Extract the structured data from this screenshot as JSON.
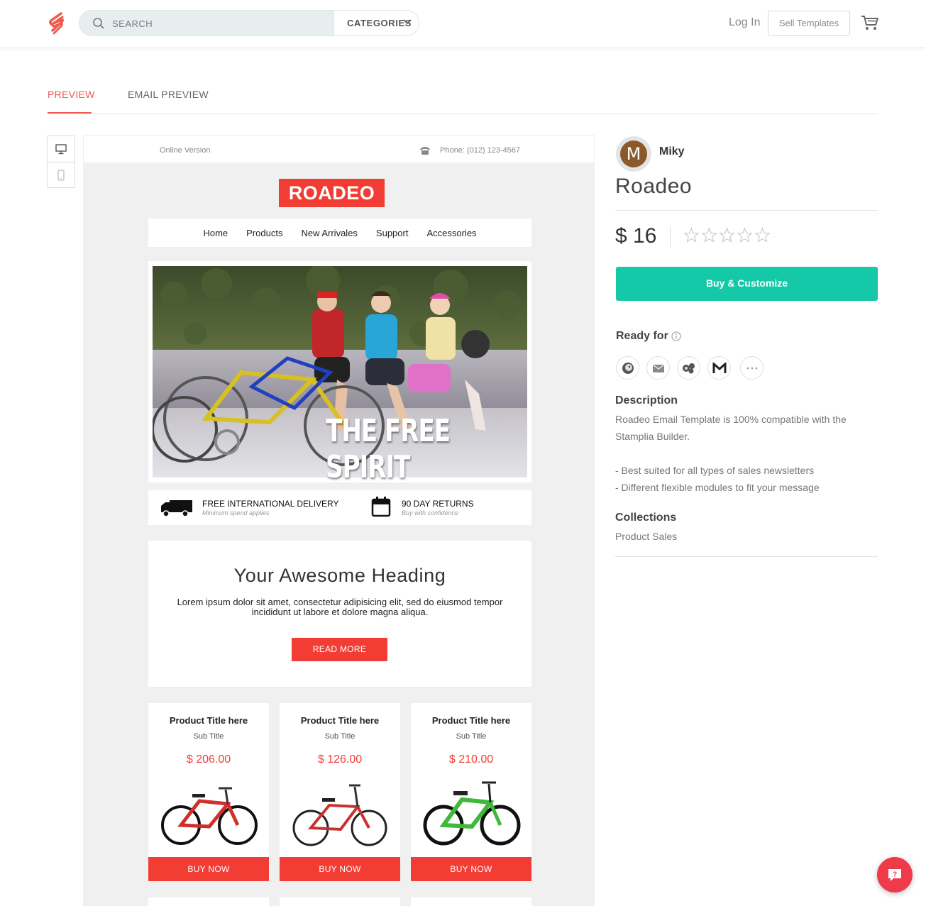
{
  "header": {
    "search_placeholder": "SEARCH",
    "categories_label": "CATEGORIES",
    "login_label": "Log In",
    "sell_label": "Sell Templates"
  },
  "tabs": {
    "preview": "PREVIEW",
    "email_preview": "EMAIL PREVIEW"
  },
  "email": {
    "online_version": "Online Version",
    "phone": "Phone: (012) 123-4567",
    "brand": "ROADEO",
    "nav": [
      "Home",
      "Products",
      "New Arrivales",
      "Support",
      "Accessories"
    ],
    "hero_text": "THE FREE SPIRIT",
    "features": [
      {
        "title": "FREE INTERNATIONAL DELIVERY",
        "subtitle": "Minimum spend applies"
      },
      {
        "title": "90 DAY RETURNS",
        "subtitle": "Buy with confidence"
      }
    ],
    "heading": "Your Awesome Heading",
    "body": "Lorem ipsum dolor sit amet, consectetur adipisicing elit, sed do eiusmod tempor incididunt ut labore et dolore magna aliqua.",
    "read_more": "READ MORE",
    "products": [
      {
        "title": "Product Title here",
        "subtitle": "Sub Title",
        "price": "$ 206.00",
        "cta": "BUY NOW",
        "color": "#d0302a"
      },
      {
        "title": "Product Title here",
        "subtitle": "Sub Title",
        "price": "$ 126.00",
        "cta": "BUY NOW",
        "color": "#c8322d"
      },
      {
        "title": "Product Title here",
        "subtitle": "Sub Title",
        "price": "$ 210.00",
        "cta": "BUY NOW",
        "color": "#3fb93a"
      }
    ]
  },
  "template": {
    "author_initial": "M",
    "author": "Miky",
    "name": "Roadeo",
    "price": "$ 16",
    "rating": 0,
    "rating_max": 5,
    "buy_label": "Buy & Customize",
    "ready_for_label": "Ready for",
    "ready_for_icons": [
      "mailchimp-icon",
      "envelope-icon",
      "campaign-monitor-icon",
      "gmail-icon",
      "more-icon"
    ],
    "description_label": "Description",
    "description_line1": "Roadeo Email Template is 100% compatible with the",
    "description_line2": "Stamplia Builder.",
    "bullet1": "- Best suited for all types of sales newsletters",
    "bullet2": "- Different flexible modules to fit your message",
    "collections_label": "Collections",
    "collection": "Product Sales"
  },
  "colors": {
    "accent": "#f05a4f",
    "email_red": "#f23d34",
    "buy_green": "#14c8a8",
    "help_red": "#ef3a4a"
  }
}
